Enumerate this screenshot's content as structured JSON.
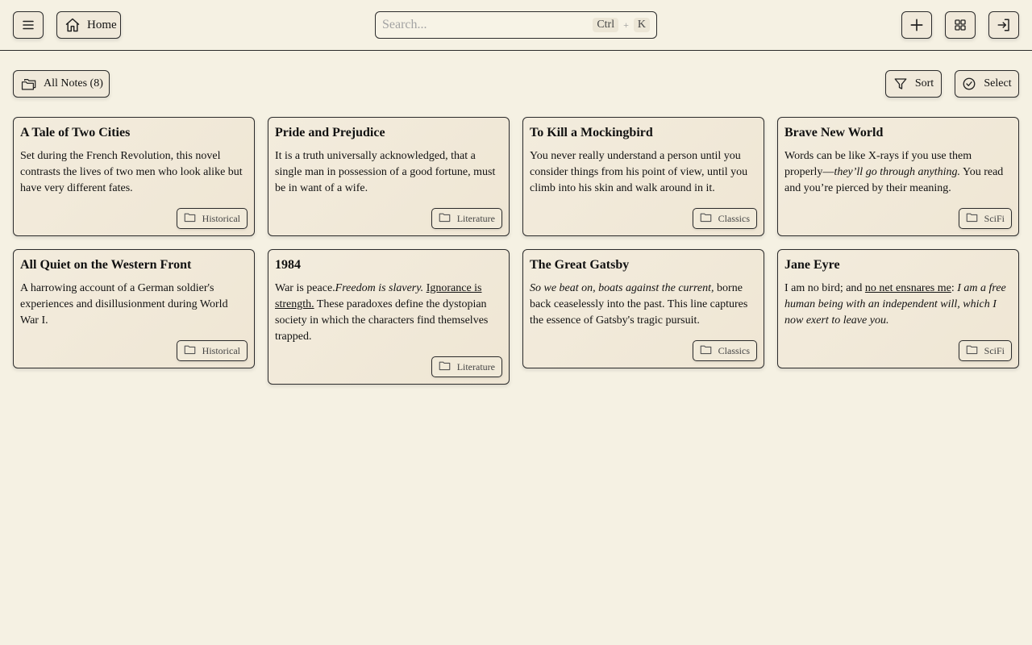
{
  "header": {
    "home_label": "Home",
    "search": {
      "placeholder": "Search...",
      "value": "",
      "shortcut_ctrl": "Ctrl",
      "shortcut_plus": "+",
      "shortcut_key": "K"
    },
    "icons": [
      "menu-icon",
      "home-icon",
      "plus-icon",
      "grid-icon",
      "login-icon"
    ]
  },
  "toolbar": {
    "all_notes_label": "All Notes (8)",
    "sort_label": "Sort",
    "select_label": "Select"
  },
  "notes": [
    {
      "title": "A Tale of Two Cities",
      "body": "Set during the French Revolution, this novel contrasts the lives of two men who look alike but have very different fates.",
      "tag": "Historical"
    },
    {
      "title": "Pride and Prejudice",
      "body": "It is a truth universally acknowledged, that a single man in possession of a good fortune, must be in want of a wife.",
      "tag": "Literature"
    },
    {
      "title": "To Kill a Mockingbird",
      "body": "You never really understand a person until you consider things from his point of view, until you climb into his skin and walk around in it.",
      "tag": "Classics"
    },
    {
      "title": "Brave New World",
      "body_parts": {
        "a": "Words can be like X-rays if you use them properly—",
        "b": "they’ll go through anything.",
        "c": " You read and you’re pierced by their meaning."
      },
      "tag": "SciFi"
    },
    {
      "title": "All Quiet on the Western Front",
      "body": "A harrowing account of a German soldier's experiences and disillusionment during World War I.",
      "tag": "Historical"
    },
    {
      "title": "1984",
      "body_parts": {
        "a": "War is peace.",
        "b": "Freedom is slavery.",
        "c": "Ignorance is strength.",
        "d": " These paradoxes define the dystopian society in which the characters find themselves trapped."
      },
      "tag": "Literature"
    },
    {
      "title": "The Great Gatsby",
      "body_parts": {
        "a": "So we beat on, boats against the current,",
        "b": " borne back ceaselessly into the past. This line captures the essence of Gatsby's tragic pursuit."
      },
      "tag": "Classics"
    },
    {
      "title": "Jane Eyre",
      "body_parts": {
        "a": "I am no bird; and ",
        "b": "no net ensnares me",
        "c": ": ",
        "d": "I am a free human being with an independent will, which I now exert to leave you."
      },
      "tag": "SciFi"
    }
  ]
}
